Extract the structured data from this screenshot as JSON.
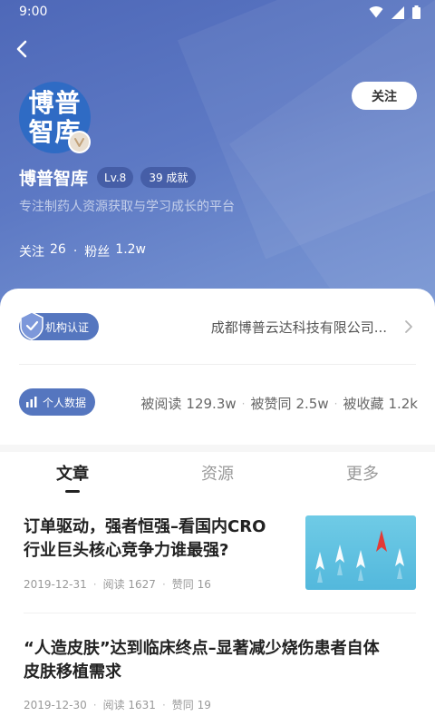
{
  "status_bar": {
    "time": "9:00"
  },
  "header": {
    "follow_label": "关注"
  },
  "profile": {
    "avatar_line1": "博普",
    "avatar_line2": "智库",
    "name": "博普智库",
    "level": "Lv.8",
    "achievements": "39 成就",
    "bio": "专注制药人资源获取与学习成长的平台",
    "following_label": "关注",
    "following_count": "26",
    "separator": "·",
    "followers_label": "粉丝",
    "followers_count": "1.2w"
  },
  "certification": {
    "badge_label": "机构认证",
    "company": "成都博普云达科技有限公司..."
  },
  "personal_data": {
    "badge_label": "个人数据",
    "reads_label": "被阅读",
    "reads": "129.3w",
    "likes_label": "被赞同",
    "likes": "2.5w",
    "favorites_label": "被收藏",
    "favorites": "1.2k",
    "separator": "·"
  },
  "tabs": [
    {
      "label": "文章",
      "active": true
    },
    {
      "label": "资源",
      "active": false
    },
    {
      "label": "更多",
      "active": false
    }
  ],
  "articles": [
    {
      "title_line1": "订单驱动，强者恒强–看国内CRO",
      "title_line2": "行业巨头核心竞争力谁最强?",
      "date": "2019-12-31",
      "reads": "阅读 1627",
      "likes": "赞同 16",
      "has_thumbnail": true
    },
    {
      "title_line1": "“人造皮肤”达到临床终点–显著减少烧伤患者自体",
      "title_line2": "皮肤移植需求",
      "date": "2019-12-30",
      "reads": "阅读 1631",
      "likes": "赞同 19",
      "has_thumbnail": false
    }
  ],
  "meta_separator": "·",
  "colors": {
    "hero_gradient_start": "#4e68b8",
    "hero_gradient_end": "#7b98d4",
    "badge_blue": "#5576bf",
    "avatar_blue": "#2f6bc4",
    "paper_plane_red": "#e23a35"
  },
  "icons": {
    "back": "chevron-left-icon",
    "wifi": "wifi-icon",
    "signal": "signal-icon",
    "battery": "battery-icon",
    "verified": "verified-badge-icon",
    "shield": "shield-check-icon",
    "chart": "bar-chart-icon",
    "chevron": "chevron-right-icon"
  }
}
